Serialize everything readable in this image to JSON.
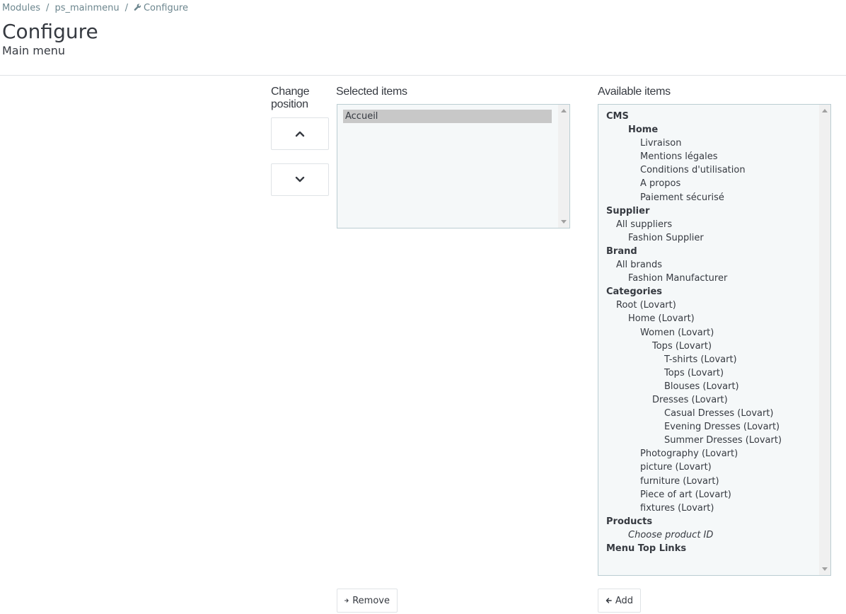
{
  "breadcrumb": {
    "items": [
      "Modules",
      "ps_mainmenu"
    ],
    "current": "Configure",
    "separator": "/"
  },
  "header": {
    "title": "Configure",
    "subtitle": "Main menu"
  },
  "position": {
    "label_line1": "Change",
    "label_line2": "position"
  },
  "selected": {
    "label": "Selected items",
    "items": [
      "Accueil"
    ]
  },
  "available": {
    "label": "Available items",
    "items": [
      {
        "text": "CMS",
        "level": 0,
        "bold": true
      },
      {
        "text": "Home",
        "level": 2,
        "bold": true
      },
      {
        "text": "Livraison",
        "level": 3
      },
      {
        "text": "Mentions légales",
        "level": 3
      },
      {
        "text": "Conditions d'utilisation",
        "level": 3
      },
      {
        "text": "A propos",
        "level": 3
      },
      {
        "text": "Paiement sécurisé",
        "level": 3
      },
      {
        "text": "Supplier",
        "level": 0,
        "bold": true
      },
      {
        "text": "All suppliers",
        "level": 1
      },
      {
        "text": "Fashion Supplier",
        "level": 2
      },
      {
        "text": "Brand",
        "level": 0,
        "bold": true
      },
      {
        "text": "All brands",
        "level": 1
      },
      {
        "text": "Fashion Manufacturer",
        "level": 2
      },
      {
        "text": "Categories",
        "level": 0,
        "bold": true
      },
      {
        "text": "Root (Lovart)",
        "level": 1
      },
      {
        "text": "Home (Lovart)",
        "level": 2
      },
      {
        "text": "Women (Lovart)",
        "level": 3
      },
      {
        "text": "Tops (Lovart)",
        "level": 4
      },
      {
        "text": "T-shirts (Lovart)",
        "level": 5
      },
      {
        "text": "Tops (Lovart)",
        "level": 5
      },
      {
        "text": "Blouses (Lovart)",
        "level": 5
      },
      {
        "text": "Dresses (Lovart)",
        "level": 4
      },
      {
        "text": "Casual Dresses (Lovart)",
        "level": 5
      },
      {
        "text": "Evening Dresses (Lovart)",
        "level": 5
      },
      {
        "text": "Summer Dresses (Lovart)",
        "level": 5
      },
      {
        "text": "Photography (Lovart)",
        "level": 3
      },
      {
        "text": "picture (Lovart)",
        "level": 3
      },
      {
        "text": "furniture (Lovart)",
        "level": 3
      },
      {
        "text": "Piece of art (Lovart)",
        "level": 3
      },
      {
        "text": "fixtures (Lovart)",
        "level": 3
      },
      {
        "text": "Products",
        "level": 0,
        "bold": true
      },
      {
        "text": "Choose product ID",
        "level": 2,
        "italic": true
      },
      {
        "text": "Menu Top Links",
        "level": 0,
        "bold": true
      }
    ]
  },
  "actions": {
    "remove_label": "Remove",
    "add_label": "Add"
  },
  "colors": {
    "text": "#363a41",
    "muted": "#6c868e",
    "listbox_bg": "#f5f8f9",
    "listbox_border": "#bbcdd2",
    "selection": "#c8c8c8"
  }
}
